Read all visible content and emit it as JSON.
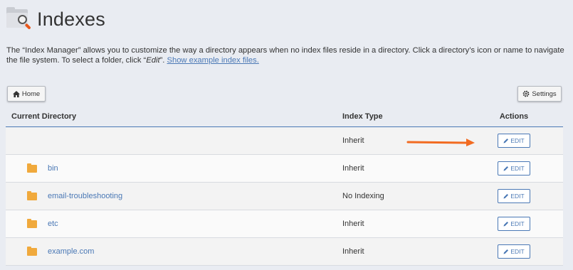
{
  "header": {
    "title": "Indexes"
  },
  "description": {
    "text_before": "The “Index Manager” allows you to customize the way a directory appears when no index files reside in a directory. Click a directory’s icon or name to navigate the file system. To select a folder, click “",
    "edit_word": "Edit",
    "text_after": "”. ",
    "link": "Show example index files."
  },
  "toolbar": {
    "home_label": "Home",
    "settings_label": "Settings"
  },
  "table": {
    "columns": {
      "directory": "Current Directory",
      "index_type": "Index Type",
      "actions": "Actions"
    },
    "rows": [
      {
        "name": "",
        "index_type": "Inherit",
        "action": "EDIT"
      },
      {
        "name": "bin",
        "index_type": "Inherit",
        "action": "EDIT"
      },
      {
        "name": "email-troubleshooting",
        "index_type": "No Indexing",
        "action": "EDIT"
      },
      {
        "name": "etc",
        "index_type": "Inherit",
        "action": "EDIT"
      },
      {
        "name": "example.com",
        "index_type": "Inherit",
        "action": "EDIT"
      }
    ]
  },
  "colors": {
    "link": "#4a78b5",
    "folder": "#f0a93c",
    "arrow": "#f26b21",
    "background": "#e9ecf2"
  },
  "icons": {
    "home": "home-icon",
    "settings": "gear-icon",
    "edit": "pencil-icon",
    "folder": "folder-icon"
  }
}
